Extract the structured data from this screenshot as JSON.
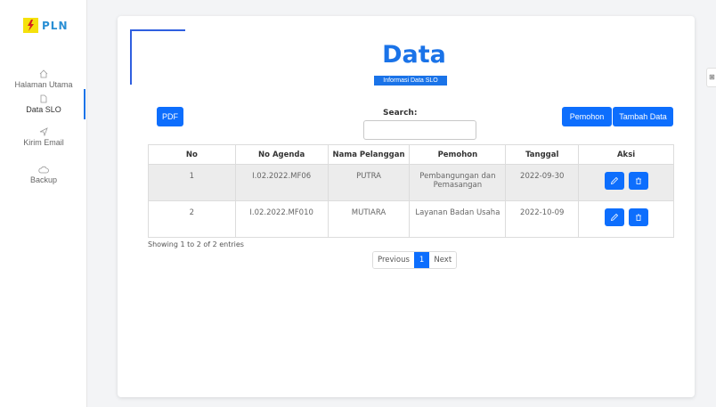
{
  "brand": {
    "name": "PLN"
  },
  "sidebar": {
    "items": [
      {
        "label": "Halaman Utama",
        "icon": "home-icon"
      },
      {
        "label": "Data SLO",
        "icon": "document-icon",
        "active": true
      },
      {
        "label": "Kirim Email",
        "icon": "send-icon"
      },
      {
        "label": "Backup",
        "icon": "cloud-icon"
      }
    ]
  },
  "header": {
    "title": "Data",
    "subtitle": "Informasi Data SLO"
  },
  "toolbar": {
    "pdf_label": "PDF",
    "search_label": "Search:",
    "search_value": "",
    "pemohon_label": "Pemohon",
    "tambah_label": "Tambah Data"
  },
  "table": {
    "columns": [
      "No",
      "No Agenda",
      "Nama Pelanggan",
      "Pemohon",
      "Tanggal",
      "Aksi"
    ],
    "rows": [
      {
        "no": "1",
        "agenda": "I.02.2022.MF06",
        "pelanggan": "PUTRA",
        "pemohon": "Pembangungan dan Pemasangan",
        "tanggal": "2022-09-30"
      },
      {
        "no": "2",
        "agenda": "I.02.2022.MF010",
        "pelanggan": "MUTIARA",
        "pemohon": "Layanan Badan Usaha",
        "tanggal": "2022-10-09"
      }
    ]
  },
  "footer": {
    "showing": "Showing 1 to 2 of 2 entries"
  },
  "pagination": {
    "previous": "Previous",
    "current": "1",
    "next": "Next"
  },
  "colors": {
    "accent": "#0d6efd",
    "title": "#1a73e8",
    "brand_blue": "#2a8fd4",
    "brand_yellow": "#f5e10c"
  }
}
